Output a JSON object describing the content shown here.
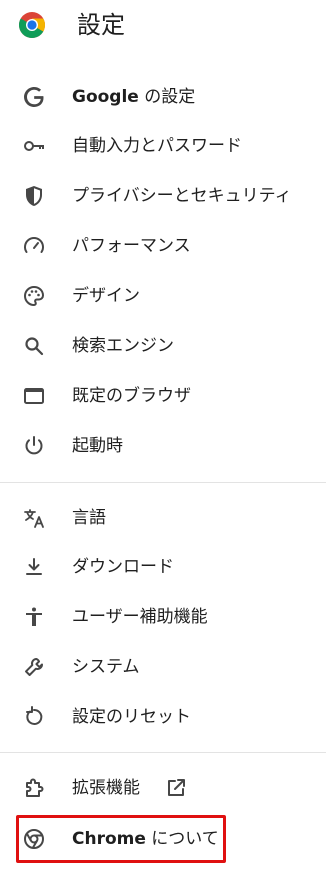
{
  "header": {
    "title": "設定",
    "logo_icon": "chrome-logo-icon"
  },
  "menu": {
    "google": {
      "prefix": "Google",
      "suffix": " の設定",
      "icon": "google-g-icon"
    },
    "autofill": {
      "label": "自動入力とパスワード",
      "icon": "key-icon"
    },
    "privacy": {
      "label": "プライバシーとセキュリティ",
      "icon": "shield-icon"
    },
    "performance": {
      "label": "パフォーマンス",
      "icon": "speedometer-icon"
    },
    "design": {
      "label": "デザイン",
      "icon": "palette-icon"
    },
    "search": {
      "label": "検索エンジン",
      "icon": "search-icon"
    },
    "default_browser": {
      "label": "既定のブラウザ",
      "icon": "browser-window-icon"
    },
    "startup": {
      "label": "起動時",
      "icon": "power-icon"
    },
    "languages": {
      "label": "言語",
      "icon": "translate-icon"
    },
    "downloads": {
      "label": "ダウンロード",
      "icon": "download-icon"
    },
    "accessibility": {
      "label": "ユーザー補助機能",
      "icon": "accessibility-icon"
    },
    "system": {
      "label": "システム",
      "icon": "wrench-icon"
    },
    "reset": {
      "label": "設定のリセット",
      "icon": "reset-icon"
    },
    "extensions": {
      "label": "拡張機能",
      "icon": "puzzle-icon",
      "link_icon": "open-in-new-icon"
    },
    "about": {
      "prefix": "Chrome",
      "suffix": " について",
      "icon": "chrome-outline-icon"
    }
  },
  "colors": {
    "text": "#1f1f1f",
    "icon": "#474747",
    "divider": "#e3e3e3",
    "highlight_border": "#e01010"
  }
}
